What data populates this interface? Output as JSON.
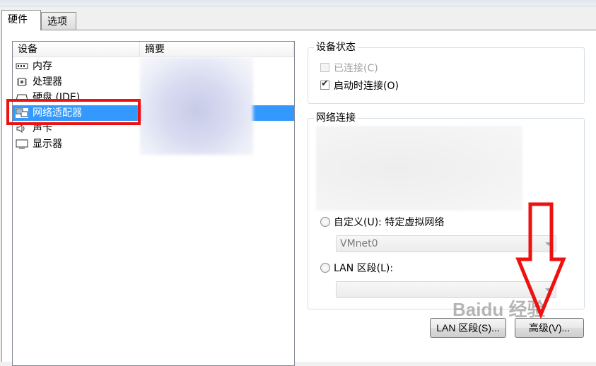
{
  "tabs": [
    {
      "label": "硬件",
      "active": true
    },
    {
      "label": "选项",
      "active": false
    }
  ],
  "device_list": {
    "columns": [
      "设备",
      "摘要"
    ],
    "items": [
      {
        "icon": "memory-icon",
        "label": "内存"
      },
      {
        "icon": "processor-icon",
        "label": "处理器"
      },
      {
        "icon": "hard-disk-icon",
        "label": "硬盘 (IDE)"
      },
      {
        "icon": "network-adapter-icon",
        "label": "网络适配器",
        "selected": true
      },
      {
        "icon": "sound-card-icon",
        "label": "声卡"
      },
      {
        "icon": "display-icon",
        "label": "显示器"
      }
    ]
  },
  "device_status": {
    "title": "设备状态",
    "connected_label": "已连接(C)",
    "connected_checked": false,
    "connected_disabled": true,
    "connect_at_poweron_label": "启动时连接(O)",
    "connect_at_poweron_checked": true
  },
  "network_connection": {
    "title": "网络连接",
    "custom_label": "自定义(U): 特定虚拟网络",
    "custom_select_value": "VMnet0",
    "lan_segment_label": "LAN 区段(L):",
    "lan_segment_value": ""
  },
  "buttons": {
    "lan_segments": "LAN 区段(S)...",
    "advanced": "高级(V)..."
  },
  "annotation": {
    "highlight_color": "#ee1111",
    "arrow_color": "#ee1111"
  },
  "watermark": "Baidu 经验"
}
